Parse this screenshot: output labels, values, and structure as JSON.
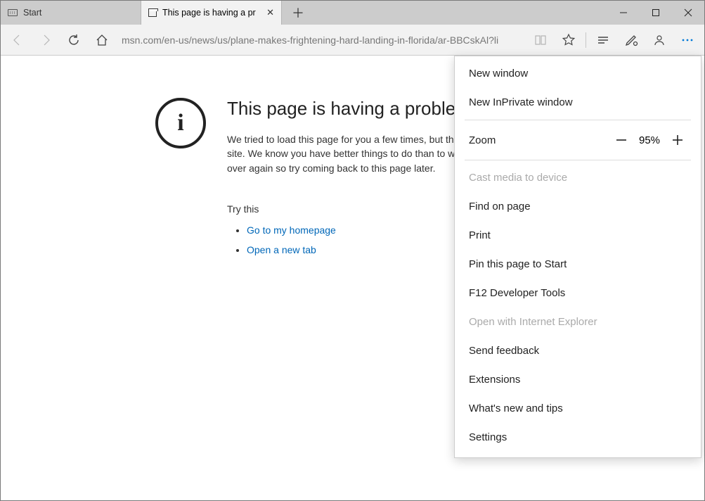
{
  "titlebar": {
    "start_tab_label": "Start",
    "active_tab_title": "This page is having a pr",
    "new_tab_glyph": "＋"
  },
  "toolbar": {
    "address": "msn.com/en-us/news/us/plane-makes-frightening-hard-landing-in-florida/ar-BBCskAl?li"
  },
  "error": {
    "info_glyph": "i",
    "heading": "This page is having a problem lo",
    "body": "We tried to load this page for you a few times, but there is still a problem with this site. We know you have better things to do than to watch this page reload over and over again so try coming back to this page later.",
    "try_label": "Try this",
    "links": [
      "Go to my homepage",
      "Open a new tab"
    ]
  },
  "menu": {
    "new_window": "New window",
    "new_inprivate": "New InPrivate window",
    "zoom_label": "Zoom",
    "zoom_value": "95%",
    "cast": "Cast media to device",
    "find": "Find on page",
    "print": "Print",
    "pin": "Pin this page to Start",
    "devtools": "F12 Developer Tools",
    "ie": "Open with Internet Explorer",
    "feedback": "Send feedback",
    "extensions": "Extensions",
    "whatsnew": "What's new and tips",
    "settings": "Settings"
  }
}
